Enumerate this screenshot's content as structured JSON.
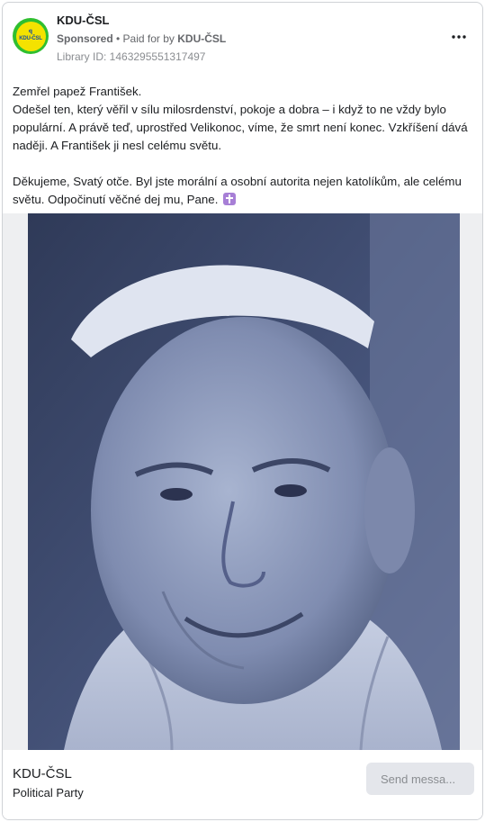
{
  "post": {
    "page_name": "KDU-ČSL",
    "logo_text": "KDU-ČSL",
    "sponsored_label": "Sponsored",
    "paid_for_prefix": " • Paid for by ",
    "paid_for_by": "KDU-ČSL",
    "library_id": "Library ID: 1463295551317497",
    "more_icon": "more-horizontal-icon"
  },
  "body": {
    "line1": "Zemřel papež František.",
    "paragraph1": "Odešel ten, který věřil v sílu milosrdenství, pokoje a dobra – i když to ne vždy bylo populární. A právě teď, uprostřed Velikonoc, víme, že smrt není konec. Vzkříšení dává naději. A František ji nesl celému světu.",
    "paragraph2": "Děkujeme, Svatý otče. Byl jste morální a osobní autorita nejen katolíkům, ale celému světu. Odpočinutí věčné dej mu, Pane.",
    "emoji_icon": "latin-cross-emoji-icon"
  },
  "footer": {
    "name": "KDU-ČSL",
    "category": "Political Party",
    "cta_label": "Send messa..."
  },
  "colors": {
    "photo_tint": "#7a88ad",
    "logo_ring": "#2fbf2f",
    "logo_fill": "#f4e200"
  }
}
